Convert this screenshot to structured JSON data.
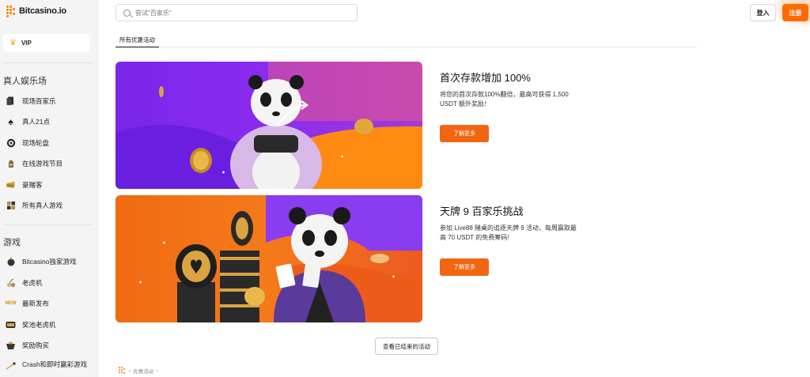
{
  "app": {
    "logo_text": "Bitcasino.io",
    "brand_color": "#ff6a00"
  },
  "sidebar": {
    "vip_label": "VIP",
    "live_casino": {
      "title": "真人娱乐场",
      "items": [
        {
          "label": "现场百家乐",
          "icon": "baccarat-card-icon"
        },
        {
          "label": "真人21点",
          "icon": "spade-icon"
        },
        {
          "label": "现场轮盘",
          "icon": "roulette-icon"
        },
        {
          "label": "在线游戏节目",
          "icon": "game-show-icon"
        },
        {
          "label": "豪赌客",
          "icon": "high-roller-icon"
        },
        {
          "label": "所有真人游戏",
          "icon": "all-live-games-icon"
        }
      ]
    },
    "games": {
      "title": "游戏",
      "items": [
        {
          "label": "Bitcasino独家游戏",
          "icon": "exclusive-games-icon"
        },
        {
          "label": "老虎机",
          "icon": "cherry-icon"
        },
        {
          "label": "最新发布",
          "icon": "new-badge-icon"
        },
        {
          "label": "奖池老虎机",
          "icon": "jackpot-slots-icon"
        },
        {
          "label": "奖励购买",
          "icon": "bonus-buy-icon"
        },
        {
          "label": "Crash和即时赢彩游戏",
          "icon": "rocket-icon"
        }
      ]
    }
  },
  "header": {
    "search_placeholder": "尝试\"百家乐\"",
    "login_label": "登入",
    "register_label": "注册"
  },
  "tabs": [
    {
      "label": "所有优惠活动",
      "active": true
    }
  ],
  "promotions": [
    {
      "title": "首次存款增加 100%",
      "description": "将您的首次存款100%翻倍，最高可获得 1,500 USDT 额外奖励！",
      "button_label": "了解更多",
      "banner": "panda-coin-banner"
    },
    {
      "title": "天牌 9 百家乐挑战",
      "description": "参加 Live88 赌桌的追逐天牌 9 活动，每周赢取最高 70 USDT 的免费筹码!",
      "button_label": "了解更多",
      "banner": "panda-chips-banner"
    }
  ],
  "ended_button_label": "查看已结束的活动",
  "breadcrumb": {
    "separator": "›",
    "current": "优惠活动"
  }
}
